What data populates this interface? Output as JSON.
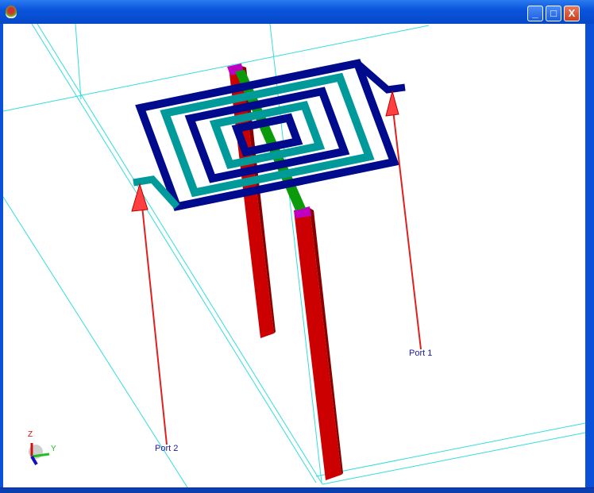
{
  "window": {
    "buttons": {
      "minimize": "_",
      "maximize": "□",
      "close": "X"
    }
  },
  "ports": [
    {
      "label": "Port 1"
    },
    {
      "label": "Port 2"
    }
  ],
  "axes": {
    "z": "Z",
    "y": "Y"
  },
  "colors": {
    "trace_blue": "#000a8c",
    "trace_teal": "#009a9a",
    "via_red": "#cc0000",
    "bridge_green": "#0a9a0a",
    "box_cyan": "#33dddd",
    "port_red": "#e02020"
  }
}
